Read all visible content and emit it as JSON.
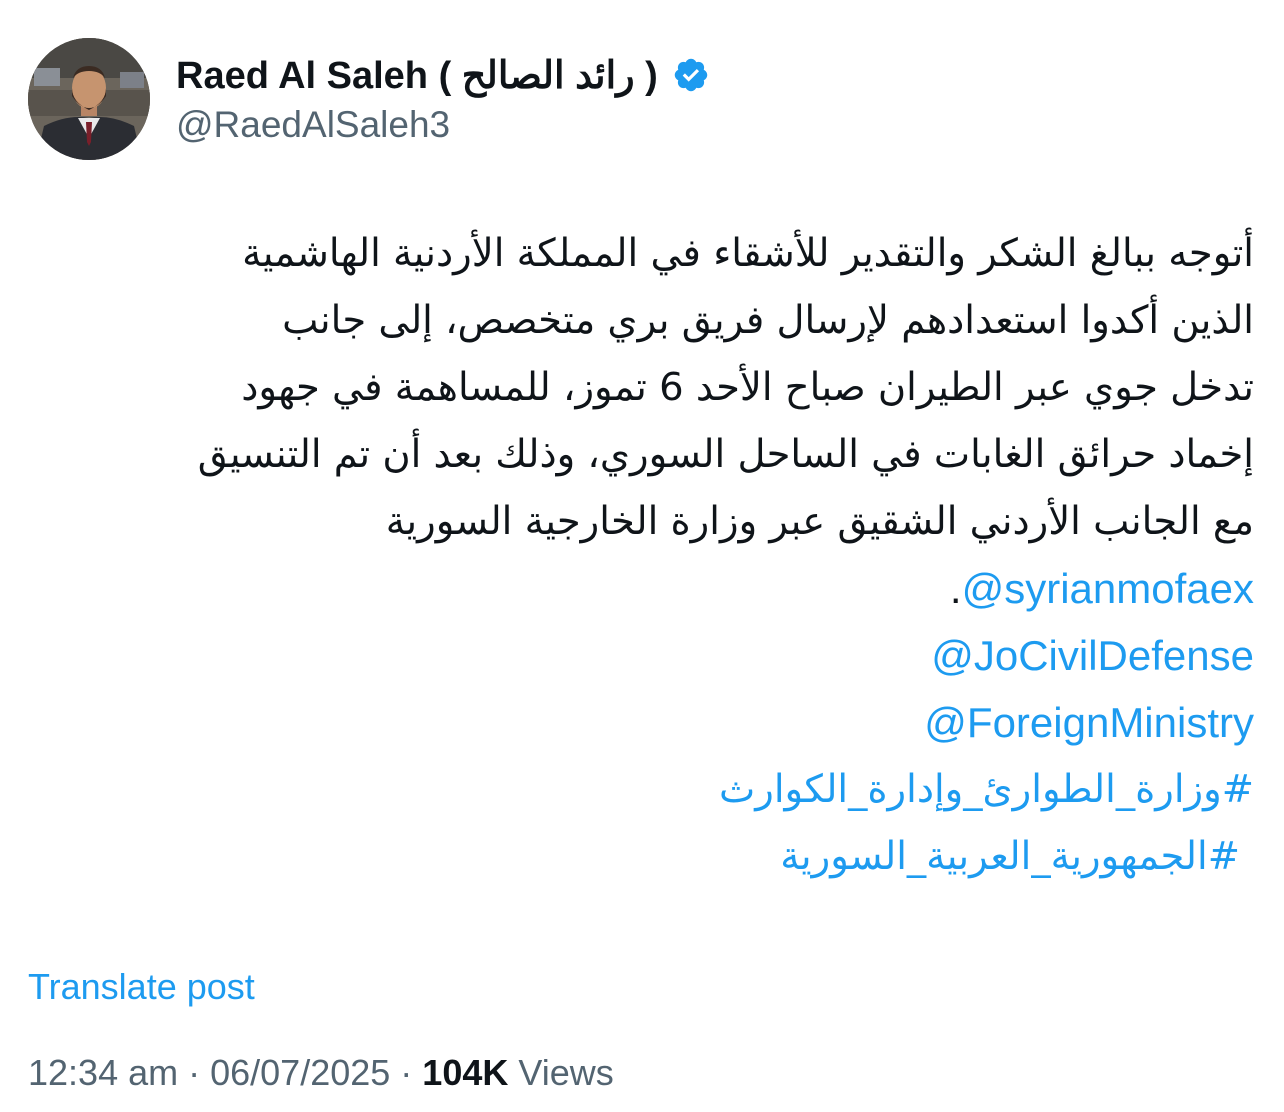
{
  "author": {
    "display_name": "Raed Al Saleh ( رائد الصالح )",
    "handle": "@RaedAlSaleh3",
    "verified": true,
    "avatar_icon": "profile-photo-man-in-suit"
  },
  "post": {
    "body_lines": [
      "أتوجه ببالغ الشكر والتقدير للأشقاء في المملكة الأردنية الهاشمية",
      "الذين أكدوا استعدادهم لإرسال فريق بري متخصص، إلى جانب",
      "تدخل جوي عبر الطيران صباح الأحد 6 تموز، للمساهمة في جهود",
      "إخماد حرائق الغابات في الساحل السوري، وذلك بعد أن تم التنسيق",
      "مع الجانب الأردني الشقيق عبر وزارة الخارجية السورية"
    ],
    "mentions": [
      "@syrianmofaex",
      "@JoCivilDefense",
      "@ForeignMinistry"
    ],
    "mention_suffix": ".",
    "hashtags": [
      "#وزارة_الطوارئ_وإدارة_الكوارث",
      "#الجمهورية_العربية_السورية"
    ]
  },
  "translate_label": "Translate post",
  "meta": {
    "time": "12:34 am",
    "separator": " · ",
    "date": "06/07/2025",
    "views_count": "104K",
    "views_label": " Views"
  },
  "colors": {
    "link": "#1d9bf0",
    "text": "#0f1419",
    "secondary": "#536471",
    "verified": "#1d9bf0"
  }
}
